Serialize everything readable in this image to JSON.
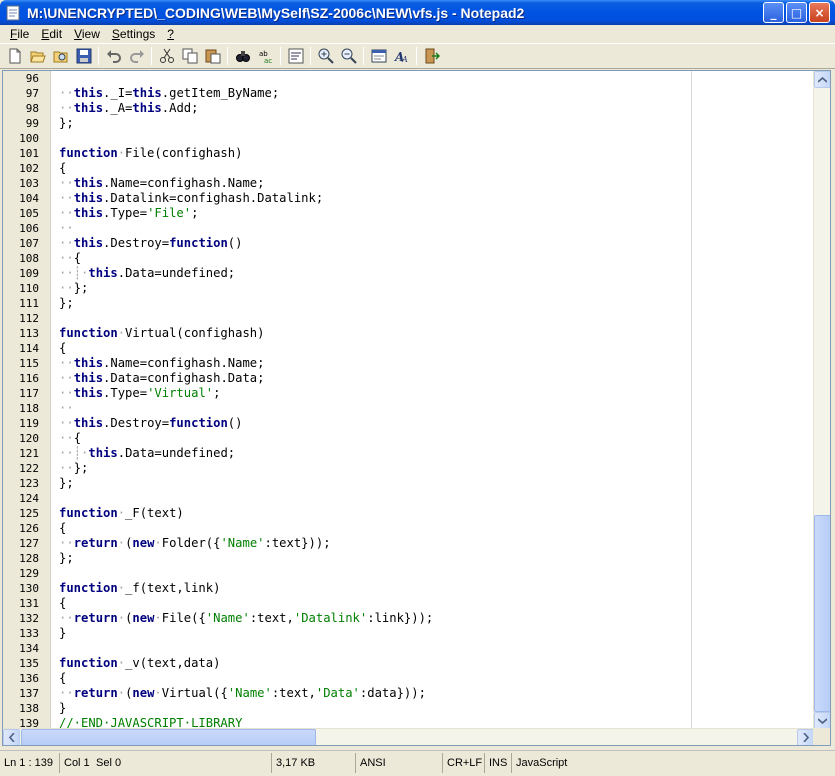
{
  "window": {
    "title": "M:\\UNENCRYPTED\\_CODING\\WEB\\MySelf\\SZ-2006c\\NEW\\vfs.js - Notepad2",
    "minimize_glyph": "_",
    "maximize_glyph": "□",
    "close_glyph": "×"
  },
  "menu": [
    {
      "label": "File",
      "accel": "F",
      "rest": "ile"
    },
    {
      "label": "Edit",
      "accel": "E",
      "rest": "dit"
    },
    {
      "label": "View",
      "accel": "V",
      "rest": "iew"
    },
    {
      "label": "Settings",
      "accel": "S",
      "rest": "ettings"
    },
    {
      "label": "?",
      "accel": "?",
      "rest": ""
    }
  ],
  "toolbar": {
    "icons": [
      "new-icon",
      "open-icon",
      "browse-icon",
      "save-icon",
      "undo-icon",
      "redo-icon",
      "cut-icon",
      "copy-icon",
      "paste-icon",
      "find-icon",
      "replace-icon",
      "word-wrap-icon",
      "zoom-in-icon",
      "zoom-out-icon",
      "scheme-icon",
      "font-icon",
      "exit-icon"
    ]
  },
  "editor": {
    "lines": [
      {
        "n": "96",
        "html": ""
      },
      {
        "n": "97",
        "html": "<span class=\"ws\">··</span><span class=\"kw\">this</span>._I=<span class=\"kw\">this</span>.getItem_ByName;"
      },
      {
        "n": "98",
        "html": "<span class=\"ws\">··</span><span class=\"kw\">this</span>._A=<span class=\"kw\">this</span>.Add;"
      },
      {
        "n": "99",
        "html": "};"
      },
      {
        "n": "100",
        "html": ""
      },
      {
        "n": "101",
        "html": "<span class=\"kw\">function</span><span class=\"ws\">·</span>File(confighash)"
      },
      {
        "n": "102",
        "html": "{"
      },
      {
        "n": "103",
        "html": "<span class=\"ws\">··</span><span class=\"kw\">this</span>.Name=confighash.Name;"
      },
      {
        "n": "104",
        "html": "<span class=\"ws\">··</span><span class=\"kw\">this</span>.Datalink=confighash.Datalink;"
      },
      {
        "n": "105",
        "html": "<span class=\"ws\">··</span><span class=\"kw\">this</span>.Type=<span class=\"str\">'File'</span>;"
      },
      {
        "n": "106",
        "html": "<span class=\"ws\">··</span>"
      },
      {
        "n": "107",
        "html": "<span class=\"ws\">··</span><span class=\"kw\">this</span>.Destroy=<span class=\"kw\">function</span>()"
      },
      {
        "n": "108",
        "html": "<span class=\"ws\">··</span>{"
      },
      {
        "n": "109",
        "html": "<span class=\"ws\">··</span><span class=\"ind\">┊·</span><span class=\"kw\">this</span>.Data=undefined;"
      },
      {
        "n": "110",
        "html": "<span class=\"ws\">··</span>};"
      },
      {
        "n": "111",
        "html": "};"
      },
      {
        "n": "112",
        "html": ""
      },
      {
        "n": "113",
        "html": "<span class=\"kw\">function</span><span class=\"ws\">·</span>Virtual(confighash)"
      },
      {
        "n": "114",
        "html": "{"
      },
      {
        "n": "115",
        "html": "<span class=\"ws\">··</span><span class=\"kw\">this</span>.Name=confighash.Name;"
      },
      {
        "n": "116",
        "html": "<span class=\"ws\">··</span><span class=\"kw\">this</span>.Data=confighash.Data;"
      },
      {
        "n": "117",
        "html": "<span class=\"ws\">··</span><span class=\"kw\">this</span>.Type=<span class=\"str\">'Virtual'</span>;"
      },
      {
        "n": "118",
        "html": "<span class=\"ws\">··</span>"
      },
      {
        "n": "119",
        "html": "<span class=\"ws\">··</span><span class=\"kw\">this</span>.Destroy=<span class=\"kw\">function</span>()"
      },
      {
        "n": "120",
        "html": "<span class=\"ws\">··</span>{"
      },
      {
        "n": "121",
        "html": "<span class=\"ws\">··</span><span class=\"ind\">┊·</span><span class=\"kw\">this</span>.Data=undefined;"
      },
      {
        "n": "122",
        "html": "<span class=\"ws\">··</span>};"
      },
      {
        "n": "123",
        "html": "};"
      },
      {
        "n": "124",
        "html": ""
      },
      {
        "n": "125",
        "html": "<span class=\"kw\">function</span><span class=\"ws\">·</span>_F(text)"
      },
      {
        "n": "126",
        "html": "{"
      },
      {
        "n": "127",
        "html": "<span class=\"ws\">··</span><span class=\"kw\">return</span><span class=\"ws\">·</span>(<span class=\"kw\">new</span><span class=\"ws\">·</span>Folder({<span class=\"str\">'Name'</span>:text}));"
      },
      {
        "n": "128",
        "html": "};"
      },
      {
        "n": "129",
        "html": ""
      },
      {
        "n": "130",
        "html": "<span class=\"kw\">function</span><span class=\"ws\">·</span>_f(text,link)"
      },
      {
        "n": "131",
        "html": "{"
      },
      {
        "n": "132",
        "html": "<span class=\"ws\">··</span><span class=\"kw\">return</span><span class=\"ws\">·</span>(<span class=\"kw\">new</span><span class=\"ws\">·</span>File({<span class=\"str\">'Name'</span>:text,<span class=\"str\">'Datalink'</span>:link}));"
      },
      {
        "n": "133",
        "html": "}"
      },
      {
        "n": "134",
        "html": ""
      },
      {
        "n": "135",
        "html": "<span class=\"kw\">function</span><span class=\"ws\">·</span>_v(text,data)"
      },
      {
        "n": "136",
        "html": "{"
      },
      {
        "n": "137",
        "html": "<span class=\"ws\">··</span><span class=\"kw\">return</span><span class=\"ws\">·</span>(<span class=\"kw\">new</span><span class=\"ws\">·</span>Virtual({<span class=\"str\">'Name'</span>:text,<span class=\"str\">'Data'</span>:data}));"
      },
      {
        "n": "138",
        "html": "}"
      },
      {
        "n": "139",
        "html": "<span class=\"cm\">//·END·JAVASCRIPT·LIBRARY</span>"
      }
    ]
  },
  "status": {
    "position": "Ln 1 : 139",
    "col": "Col 1",
    "sel": "Sel 0",
    "size": "3,17 KB",
    "encoding": "ANSI",
    "eol": "CR+LF",
    "mode": "INS",
    "lexer": "JavaScript"
  }
}
